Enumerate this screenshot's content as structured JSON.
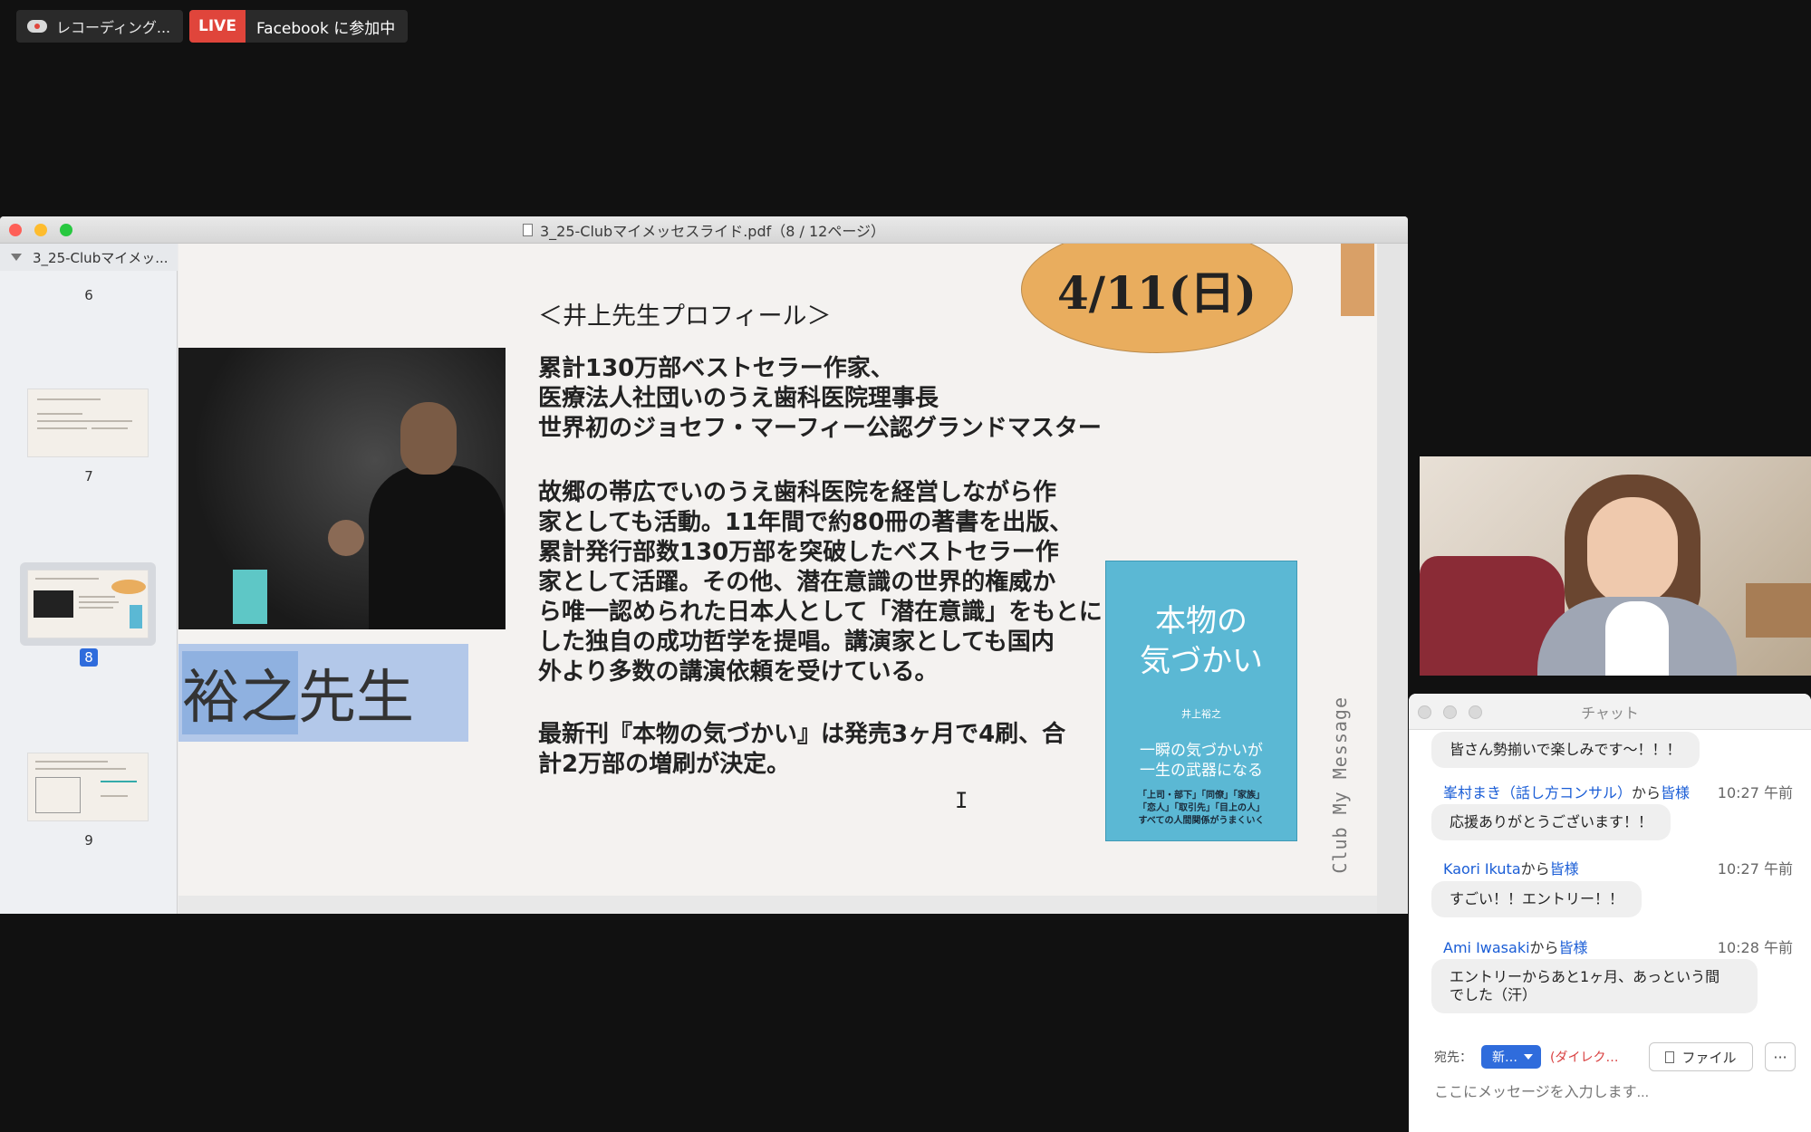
{
  "topbar": {
    "recording_label": "レコーディング...",
    "live_tag": "LIVE",
    "live_label": "Facebook に参加中"
  },
  "pdf_window": {
    "title": "3_25-Clubマイメッセスライド.pdf（8 / 12ページ）",
    "sidebar": {
      "doc_name": "3_25-Clubマイメッ...",
      "pages": [
        "6",
        "7",
        "8",
        "9"
      ],
      "selected_page": "8"
    },
    "slide": {
      "date_badge": "4/11(日)",
      "profile_title": "＜井上先生プロフィール＞",
      "profile_lines_1": "累計130万部ベストセラー作家、\n医療法人社団いのうえ歯科医院理事長\n世界初のジョセフ・マーフィー公認グランドマスター",
      "profile_lines_2": "故郷の帯広でいのうえ歯科医院を経営しながら作\n家としても活動。11年間で約80冊の著書を出版、\n累計発行部数130万部を突破したベストセラー作\n家として活躍。その他、潜在意識の世界的権威か\nら唯一認められた日本人として「潜在意識」をもとに\nした独自の成功哲学を提唱。講演家としても国内\n外より多数の講演依頼を受けている。",
      "profile_lines_3": "最新刊『本物の気づかい』は発売3ヶ月で4刷、合\n計2万部の増刷が決定。",
      "name_highlight": "裕之",
      "name_rest": "先生",
      "book_title": "本物の\n気づかい",
      "book_author": "井上裕之",
      "book_subtitle": "一瞬の気づかいが\n一生の武器になる",
      "book_band": "「上司・部下」「同僚」「家族」\n「恋人」「取引先」「目上の人」\nすべての人間関係がうまくいく",
      "vertical_text": "Club My Message"
    }
  },
  "chat": {
    "title": "チャット",
    "messages": [
      {
        "text": "皆さん勢揃いで楽しみです〜！！！"
      },
      {
        "sender": "峯村まき（話し方コンサル）",
        "from": "から",
        "to": "皆様",
        "time": "10:27 午前",
        "text": "応援ありがとうございます！！"
      },
      {
        "sender": "Kaori Ikuta",
        "from": "から",
        "to": "皆様",
        "time": "10:27 午前",
        "text": "すごい！！エントリー！！"
      },
      {
        "sender": "Ami Iwasaki",
        "from": "から",
        "to": "皆様",
        "time": "10:28 午前",
        "text": "エントリーからあと1ヶ月、あっという間\nでした（汗）"
      }
    ],
    "to_label": "宛先：",
    "to_value": "新…",
    "direct_label": "(ダイレク…",
    "file_button": "ファイル",
    "more_button": "···",
    "input_placeholder": "ここにメッセージを入力します..."
  }
}
